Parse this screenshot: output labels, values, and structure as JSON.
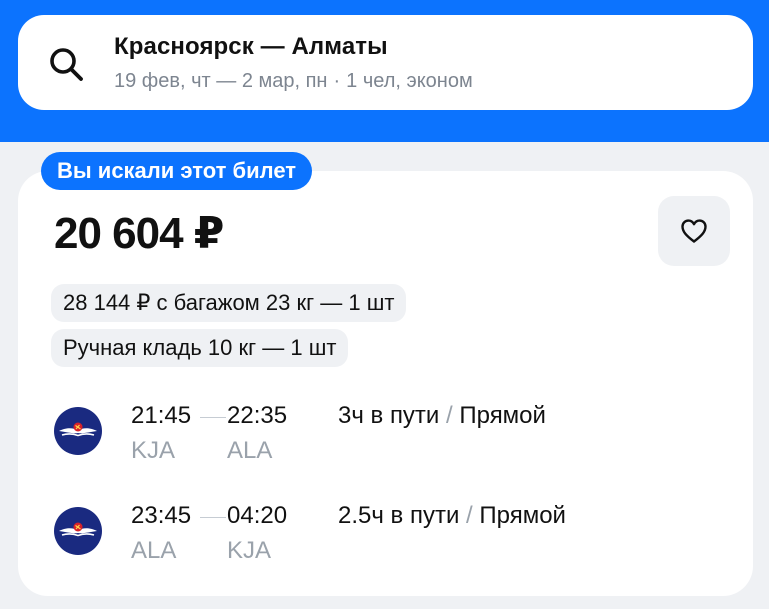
{
  "search": {
    "route": "Красноярск — Алматы",
    "dates": "19 фев, чт — 2 мар, пн",
    "separator": "·",
    "passengers": "1 чел, эконом"
  },
  "ticket": {
    "badge": "Вы искали этот билет",
    "price": "20 604 ₽",
    "baggage_option": "28 144 ₽ с багажом 23 кг — 1 шт",
    "hand_luggage": "Ручная кладь 10 кг — 1 шт"
  },
  "segments": [
    {
      "depart_time": "21:45",
      "arrive_time": "22:35",
      "depart_code": "KJA",
      "arrive_code": "ALA",
      "duration": "3ч в пути",
      "slash": "/",
      "type": "Прямой"
    },
    {
      "depart_time": "23:45",
      "arrive_time": "04:20",
      "depart_code": "ALA",
      "arrive_code": "KJA",
      "duration": "2.5ч в пути",
      "slash": "/",
      "type": "Прямой"
    }
  ],
  "icons": {
    "search": "search-icon",
    "favorite": "heart-icon",
    "airline": "airline-logo"
  },
  "colors": {
    "brand_blue": "#0c73fe",
    "background": "#eff1f4",
    "airline_navy": "#1a2a80"
  }
}
